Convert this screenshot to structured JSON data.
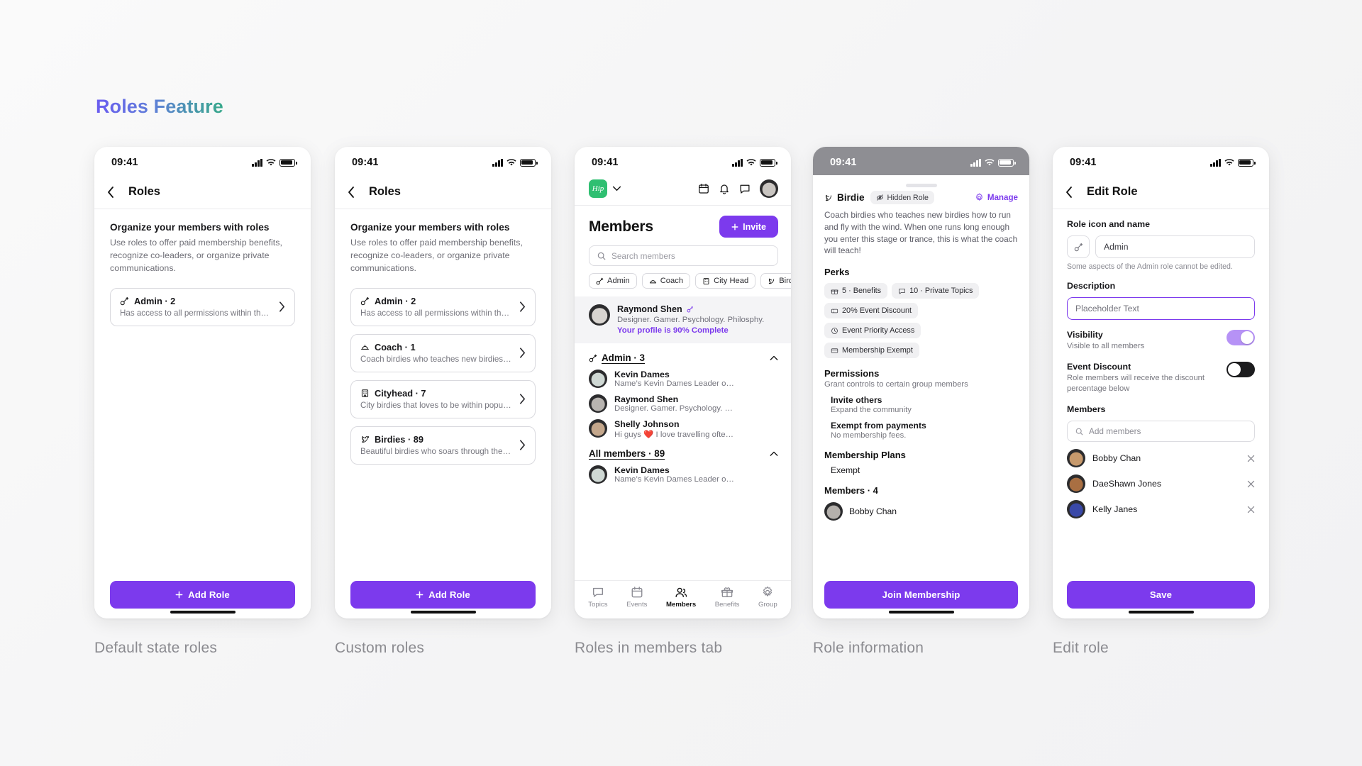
{
  "page": {
    "title": "Roles Feature"
  },
  "status_bar": {
    "time": "09:41"
  },
  "icons": {
    "back": "chevron-left-icon",
    "chevron_right": "chevron-right-icon",
    "signal": "cellular-signal-icon",
    "wifi": "wifi-icon",
    "battery": "battery-icon"
  },
  "panels": [
    {
      "caption": "Default state roles",
      "nav_title": "Roles",
      "intro": {
        "heading": "Organize your members with roles",
        "body": "Use roles to offer paid membership benefits, recognize co-leaders, or organize private communications."
      },
      "roles": [
        {
          "icon": "key-icon",
          "title": "Admin · 2",
          "subtitle": "Has access to all permissions within the ..."
        }
      ],
      "cta": "Add Role"
    },
    {
      "caption": "Custom roles",
      "nav_title": "Roles",
      "intro": {
        "heading": "Organize your members with roles",
        "body": "Use roles to offer paid membership benefits, recognize co-leaders, or organize private communications."
      },
      "roles": [
        {
          "icon": "key-icon",
          "title": "Admin · 2",
          "subtitle": "Has access to all permissions within the ..."
        },
        {
          "icon": "cap-icon",
          "title": "Coach · 1",
          "subtitle": "Coach birdies who teaches new birdies h..."
        },
        {
          "icon": "building-icon",
          "title": "Cityhead · 7",
          "subtitle": "City birdies that loves to be within popula..."
        },
        {
          "icon": "bird-icon",
          "title": "Birdies · 89",
          "subtitle": "Beautiful birdies who soars through the ci..."
        }
      ],
      "cta": "Add Role"
    }
  ],
  "members_panel": {
    "caption": "Roles in members tab",
    "logo_text": "Hip",
    "header_icons": [
      "calendar-icon",
      "bell-icon",
      "chat-icon",
      "avatar"
    ],
    "title": "Members",
    "invite_label": "Invite",
    "search_placeholder": "Search members",
    "role_chips": [
      {
        "icon": "key-icon",
        "label": "Admin"
      },
      {
        "icon": "cap-icon",
        "label": "Coach"
      },
      {
        "icon": "building-icon",
        "label": "City Head"
      },
      {
        "icon": "bird-icon",
        "label": "Birdies"
      }
    ],
    "promo": {
      "name": "Raymond Shen",
      "role_icon": "key-icon",
      "subtitle": "Designer. Gamer. Psychology. Philosphy.",
      "link": "Your profile is 90% Complete"
    },
    "sections": [
      {
        "icon": "key-icon",
        "title": "Admin · 3",
        "collapse_icon": "chevron-up-icon",
        "members": [
          {
            "name": "Kevin Dames",
            "desc": "Name’s Kevin Dames Leader of this group.",
            "avatar_color": "#cfd8d4"
          },
          {
            "name": "Raymond Shen",
            "desc": "Designer. Gamer. Psychology. Philosphy.",
            "avatar_color": "#2c2c2e"
          },
          {
            "name": "Shelly Johnson",
            "desc": "Hi guys ❤️ I love travelling often so I joined th...",
            "avatar_color": "#b9a48d"
          }
        ]
      },
      {
        "title": "All members · 89",
        "collapse_icon": "chevron-up-icon",
        "members": [
          {
            "name": "Kevin Dames",
            "desc": "Name’s Kevin Dames Leader of this group.",
            "avatar_color": "#cfd8d4"
          }
        ]
      }
    ],
    "tabs": [
      {
        "icon": "chat-icon",
        "label": "Topics",
        "active": false
      },
      {
        "icon": "calendar-icon",
        "label": "Events",
        "active": false
      },
      {
        "icon": "members-icon",
        "label": "Members",
        "active": true
      },
      {
        "icon": "gift-icon",
        "label": "Benefits",
        "active": false
      },
      {
        "icon": "gear-icon",
        "label": "Group",
        "active": false
      }
    ]
  },
  "role_info_panel": {
    "caption": "Role information",
    "role_icon": "bird-icon",
    "role_name": "Birdie",
    "hidden_badge": {
      "icon": "eye-off-icon",
      "label": "Hidden Role"
    },
    "manage": {
      "icon": "gear-icon",
      "label": "Manage"
    },
    "description": "Coach birdies who teaches new birdies how to run and fly with the wind. When one runs long enough you enter this stage or trance, this is what the coach will teach!",
    "perks_heading": "Perks",
    "perks": [
      {
        "icon": "gift-icon",
        "label": "5 · Benefits"
      },
      {
        "icon": "chat-icon",
        "label": "10 · Private Topics"
      },
      {
        "icon": "ticket-icon",
        "label": "20% Event Discount"
      },
      {
        "icon": "clock-icon",
        "label": "Event Priority Access"
      },
      {
        "icon": "card-icon",
        "label": "Membership Exempt"
      }
    ],
    "permissions_heading": "Permissions",
    "permissions_sub": "Grant controls to certain group members",
    "permissions": [
      {
        "title": "Invite others",
        "subtitle": "Expand the community"
      },
      {
        "title": "Exempt from payments",
        "subtitle": "No membership fees."
      }
    ],
    "plans_heading": "Membership Plans",
    "plans": [
      "Exempt"
    ],
    "members_heading": "Members · 4",
    "members": [
      {
        "name": "Bobby Chan",
        "avatar_color": "#4a4a50"
      }
    ],
    "cta": "Join Membership"
  },
  "edit_panel": {
    "caption": "Edit role",
    "nav_title": "Edit Role",
    "icon_name_label": "Role icon and name",
    "role_icon": "key-icon",
    "role_name_value": "Admin",
    "icon_name_hint": "Some aspects of the Admin role cannot be edited.",
    "description_label": "Description",
    "description_value": "Placeholder Text",
    "visibility": {
      "title": "Visibility",
      "subtitle": "Visible to all members",
      "state": "on"
    },
    "event_discount": {
      "title": "Event Discount",
      "subtitle": "Role members will receive the discount percentage below",
      "state": "off"
    },
    "members_label": "Members",
    "add_members_placeholder": "Add members",
    "members": [
      {
        "name": "Bobby Chan",
        "avatar_color": "#6b5a4a",
        "remove_icon": "close-icon"
      },
      {
        "name": "DaeShawn Jones",
        "avatar_color": "#8a5a3a",
        "remove_icon": "close-icon"
      },
      {
        "name": "Kelly Janes",
        "avatar_color": "#2f3a8a",
        "remove_icon": "close-icon"
      }
    ],
    "cta": "Save"
  },
  "colors": {
    "accent": "#7c3aed",
    "green": "#2fbf71",
    "toggle_on": "#b692f6",
    "toggle_off": "#1c1c1e"
  }
}
